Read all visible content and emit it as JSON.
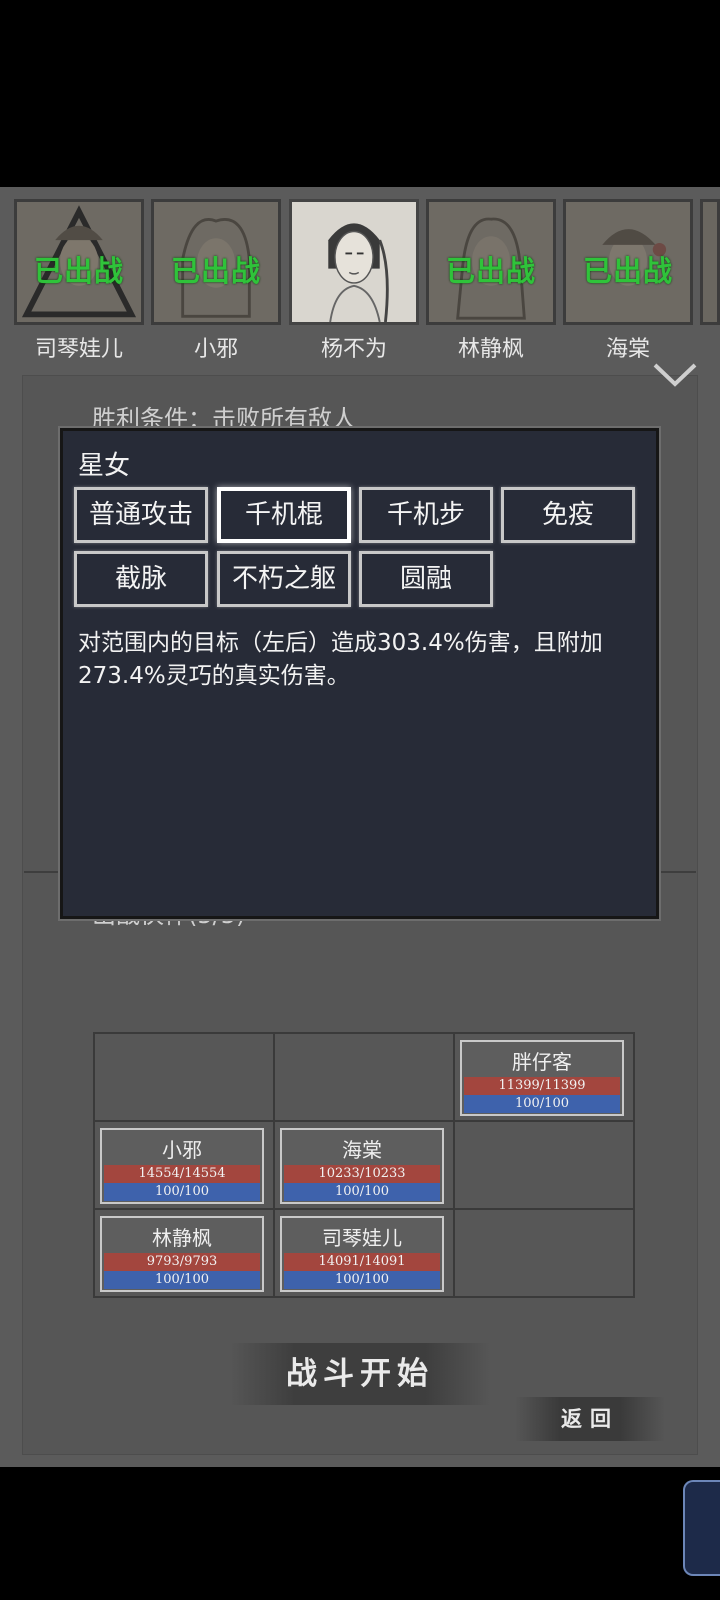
{
  "party": [
    {
      "name": "司琴娃儿",
      "status": "已出战",
      "selected": false
    },
    {
      "name": "小邪",
      "status": "已出战",
      "selected": false
    },
    {
      "name": "杨不为",
      "status": "",
      "selected": true
    },
    {
      "name": "林静枫",
      "status": "已出战",
      "selected": false
    },
    {
      "name": "海棠",
      "status": "已出战",
      "selected": false
    }
  ],
  "panel": {
    "victory_condition": "胜利条件：击败所有敌人",
    "partners_title": "出战伙伴(5/5)"
  },
  "formation": {
    "row1": {
      "c3": {
        "name": "胖仔客",
        "hp": "11399/11399",
        "mp": "100/100"
      }
    },
    "row2": {
      "c1": {
        "name": "小邪",
        "hp": "14554/14554",
        "mp": "100/100"
      },
      "c2": {
        "name": "海棠",
        "hp": "10233/10233",
        "mp": "100/100"
      }
    },
    "row3": {
      "c1": {
        "name": "林静枫",
        "hp": "9793/9793",
        "mp": "100/100"
      },
      "c2": {
        "name": "司琴娃儿",
        "hp": "14091/14091",
        "mp": "100/100"
      }
    }
  },
  "buttons": {
    "start": "战斗开始",
    "back": "返回"
  },
  "modal": {
    "title": "星女",
    "skills": [
      "普通攻击",
      "千机棍",
      "千机步",
      "免疫",
      "截脉",
      "不朽之躯",
      "圆融"
    ],
    "active_skill": "千机棍",
    "description": "对范围内的目标（左后）造成303.4%伤害，且附加273.4%灵巧的真实伤害。"
  },
  "colors": {
    "deployed": "#2fc33a",
    "hp_bar": "#a3463e",
    "mp_bar": "#3e62ac",
    "modal_bg": "#272b37"
  }
}
